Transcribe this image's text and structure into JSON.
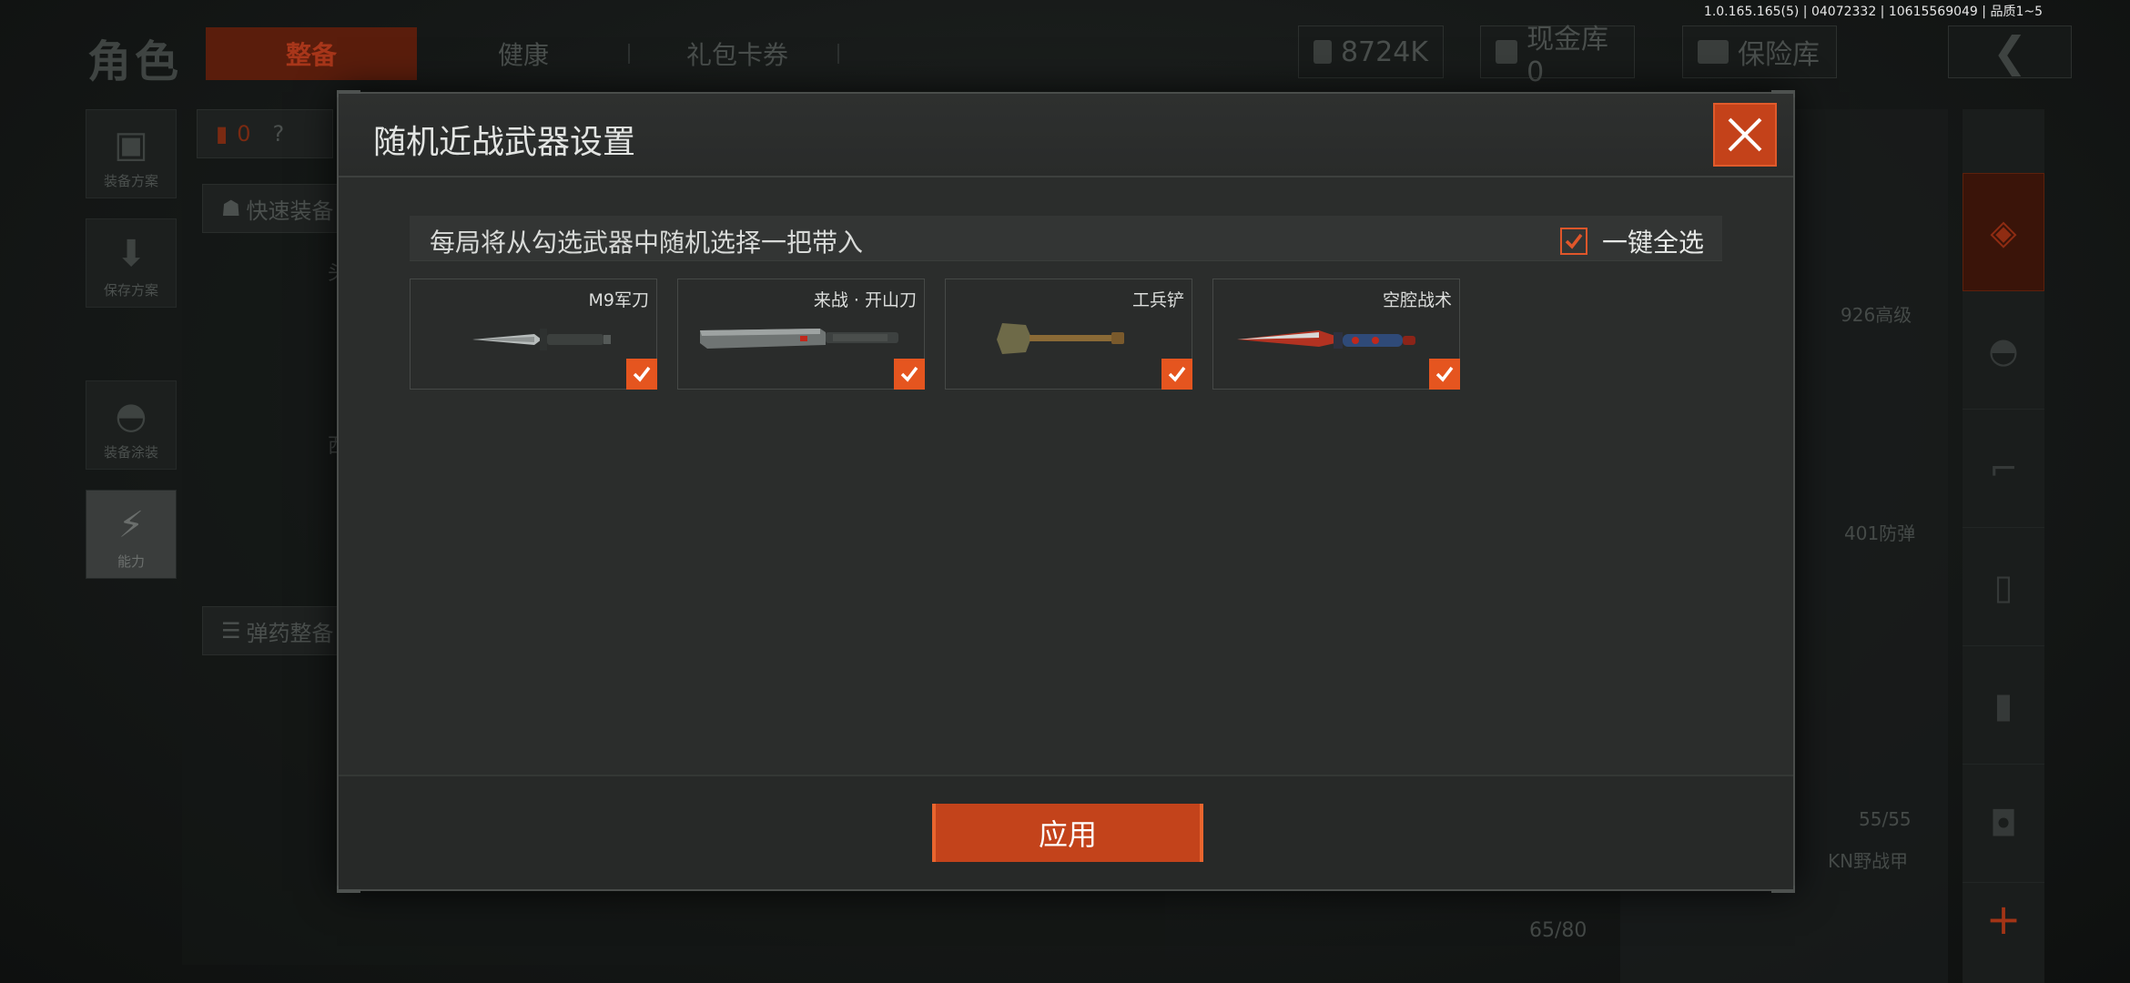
{
  "version_text": "1.0.165.165(5) | 04072332 | 10615569049 | 品质1~5",
  "header": {
    "page_title": "角色",
    "tabs": [
      {
        "label": "整备",
        "active": true
      },
      {
        "label": "健康",
        "active": false
      },
      {
        "label": "礼包卡券",
        "active": false
      }
    ],
    "currency": "8724K",
    "cash_vault": "现金库 0",
    "safe_vault": "保险库"
  },
  "left_rail": {
    "items": [
      {
        "label": "装备方案",
        "icon": "vest-icon"
      },
      {
        "label": "保存方案",
        "icon": "download-icon"
      },
      {
        "label": "装备涂装",
        "icon": "helmet-icon"
      },
      {
        "label": "能力",
        "icon": "lightning-icon"
      }
    ]
  },
  "background": {
    "armor_count": "0",
    "help": "?",
    "quick_equip": "快速装备",
    "ammo_setup": "弹药整备",
    "item_926": "926高级",
    "item_401": "401防弹",
    "durability_1": "55/55",
    "item_kn": "KN野战甲",
    "durability_2": "65/80",
    "side_letter_1": "头",
    "side_letter_2": "西"
  },
  "modal": {
    "title": "随机近战武器设置",
    "subtitle": "每局将从勾选武器中随机选择一把带入",
    "select_all_label": "一键全选",
    "select_all_checked": true,
    "weapons": [
      {
        "name": "M9军刀",
        "checked": true,
        "icon": "combat-knife-icon"
      },
      {
        "name": "来战 · 开山刀",
        "checked": true,
        "icon": "machete-icon"
      },
      {
        "name": "工兵铲",
        "checked": true,
        "icon": "shovel-icon"
      },
      {
        "name": "空腔战术",
        "checked": true,
        "icon": "tactical-dagger-icon"
      }
    ],
    "apply_label": "应用"
  },
  "colors": {
    "accent": "#e5551f",
    "modal_bg": "#2b2d2c",
    "apply_bg": "#c3431b"
  }
}
